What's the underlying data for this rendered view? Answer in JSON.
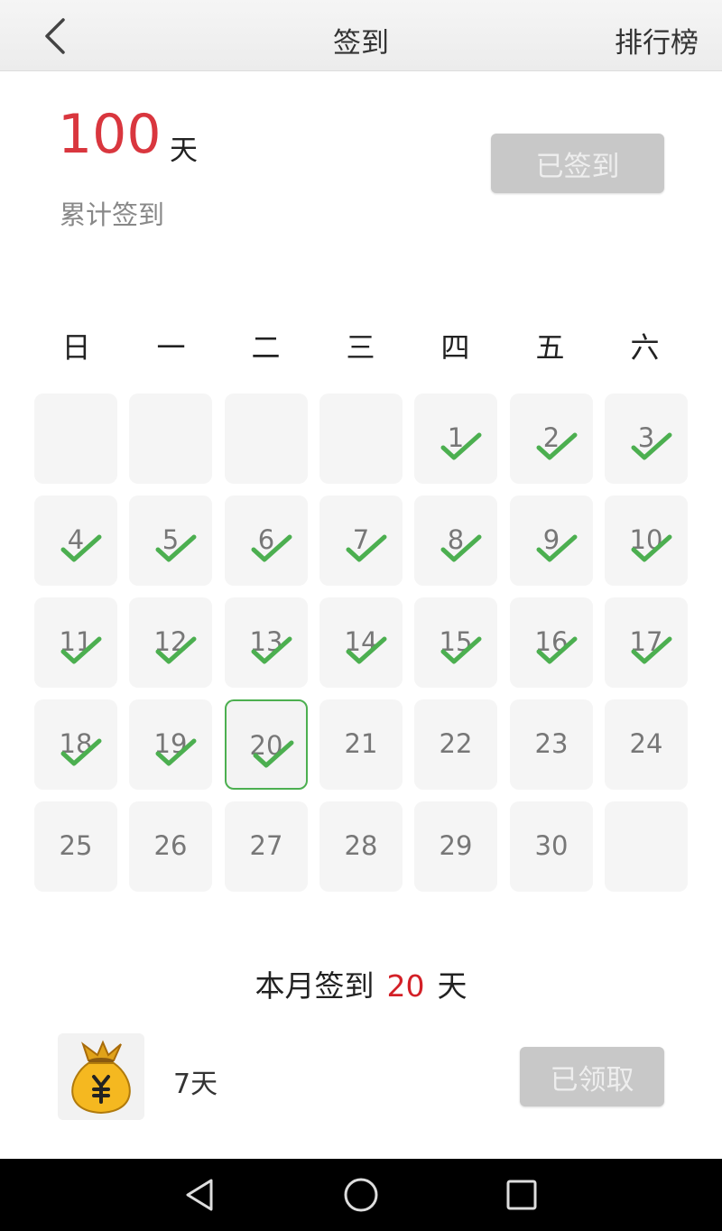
{
  "header": {
    "back_icon": "chevron-left-icon",
    "title": "签到",
    "ranking_label": "排行榜"
  },
  "summary": {
    "total_days": "100",
    "total_unit": "天",
    "total_label": "累计签到",
    "signin_button_label": "已签到"
  },
  "calendar": {
    "weekdays": [
      "日",
      "一",
      "二",
      "三",
      "四",
      "五",
      "六"
    ],
    "first_weekday_index": 4,
    "days_in_month": 30,
    "checked_days": [
      1,
      2,
      3,
      4,
      5,
      6,
      7,
      8,
      9,
      10,
      11,
      12,
      13,
      14,
      15,
      16,
      17,
      18,
      19,
      20
    ],
    "today": 20,
    "colors": {
      "check": "#4caf50",
      "today_border": "#4caf50",
      "cell_bg": "#f5f5f5",
      "accent_red": "#d9363e"
    }
  },
  "month_summary": {
    "prefix": "本月签到",
    "count": "20",
    "suffix": "天"
  },
  "rewards": [
    {
      "icon": "money-bag-icon",
      "days_label": "7天",
      "button_label": "已领取"
    }
  ],
  "navbar": {
    "icons": [
      "back-triangle-icon",
      "home-circle-icon",
      "recents-square-icon"
    ]
  }
}
